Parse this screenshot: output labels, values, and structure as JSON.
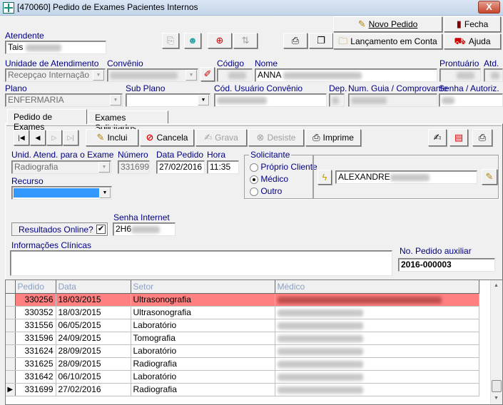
{
  "window": {
    "title": "[470060]  Pedido de Exames Pacientes Internos",
    "close_label": "X"
  },
  "header": {
    "atendente_label": "Atendente",
    "atendente_value": "Tais",
    "buttons": {
      "novo_pedido": "Novo Pedido",
      "fecha": "Fecha",
      "lancamento": "Lançamento em Conta",
      "ajuda": "Ajuda"
    },
    "unidade_label": "Unidade de Atendimento",
    "unidade_value": "Recepçao Internação",
    "convenio_label": "Convênio",
    "codigo_label": "Código",
    "nome_label": "Nome",
    "nome_value": "ANNA",
    "prontuario_label": "Prontuário",
    "atd_label": "Atd.",
    "plano_label": "Plano",
    "plano_value": "ENFERMARIA",
    "subplano_label": "Sub Plano",
    "subplano_value": "",
    "cod_usuario_label": "Cód. Usuário Convênio",
    "dep_label": "Dep.",
    "num_guia_label": "Num. Guia / Comprovante",
    "senha_label": "Senha / Autoriz."
  },
  "tabs": [
    {
      "label": "Pedido de Exames",
      "active": true
    },
    {
      "label": "Exames Solicitados",
      "active": false
    }
  ],
  "toolbar": {
    "incluir": "Inclui",
    "cancelar": "Cancela",
    "gravar": "Grava",
    "desistir": "Desiste",
    "imprimir": "Imprime"
  },
  "form": {
    "unid_exame_label": "Unid. Atend. para o Exame",
    "unid_exame_value": "Radiografia",
    "numero_label": "Número",
    "numero_value": "331699",
    "data_label": "Data Pedido",
    "data_value": "27/02/2016",
    "hora_label": "Hora",
    "hora_value": "11:35",
    "recurso_label": "Recurso",
    "recurso_value": "",
    "solicitante_label": "Solicitante",
    "solicitante_options": [
      {
        "label": "Próprio Cliente",
        "selected": false
      },
      {
        "label": "Médico",
        "selected": true
      },
      {
        "label": "Outro",
        "selected": false
      }
    ],
    "solicitante_value": "ALEXANDRE",
    "resultados_online_label": "Resultados Online?",
    "resultados_online_checked": true,
    "senha_internet_label": "Senha Internet",
    "senha_internet_value": "2H6",
    "info_clinicas_label": "Informações Clínicas",
    "info_clinicas_value": "",
    "no_pedido_aux_label": "No. Pedido auxiliar",
    "no_pedido_aux_value": "2016-000003"
  },
  "grid": {
    "columns": [
      "Pedido",
      "Data",
      "Setor",
      "Médico"
    ],
    "rows": [
      {
        "pedido": "330256",
        "data": "18/03/2015",
        "setor": "Ultrasonografia",
        "highlight": true,
        "current": false
      },
      {
        "pedido": "330352",
        "data": "18/03/2015",
        "setor": "Ultrasonografia",
        "highlight": false,
        "current": false
      },
      {
        "pedido": "331556",
        "data": "06/05/2015",
        "setor": "Laboratório",
        "highlight": false,
        "current": false
      },
      {
        "pedido": "331596",
        "data": "24/09/2015",
        "setor": "Tomografia",
        "highlight": false,
        "current": false
      },
      {
        "pedido": "331624",
        "data": "28/09/2015",
        "setor": "Laboratório",
        "highlight": false,
        "current": false
      },
      {
        "pedido": "331625",
        "data": "28/09/2015",
        "setor": "Radiografia",
        "highlight": false,
        "current": false
      },
      {
        "pedido": "331642",
        "data": "06/10/2015",
        "setor": "Laboratório",
        "highlight": false,
        "current": false
      },
      {
        "pedido": "331699",
        "data": "27/02/2016",
        "setor": "Radiografia",
        "highlight": false,
        "current": true
      }
    ]
  },
  "colors": {
    "highlight_row": "#ff8080",
    "recurso_selected": "#3399ff",
    "label_blue": "#000080"
  }
}
